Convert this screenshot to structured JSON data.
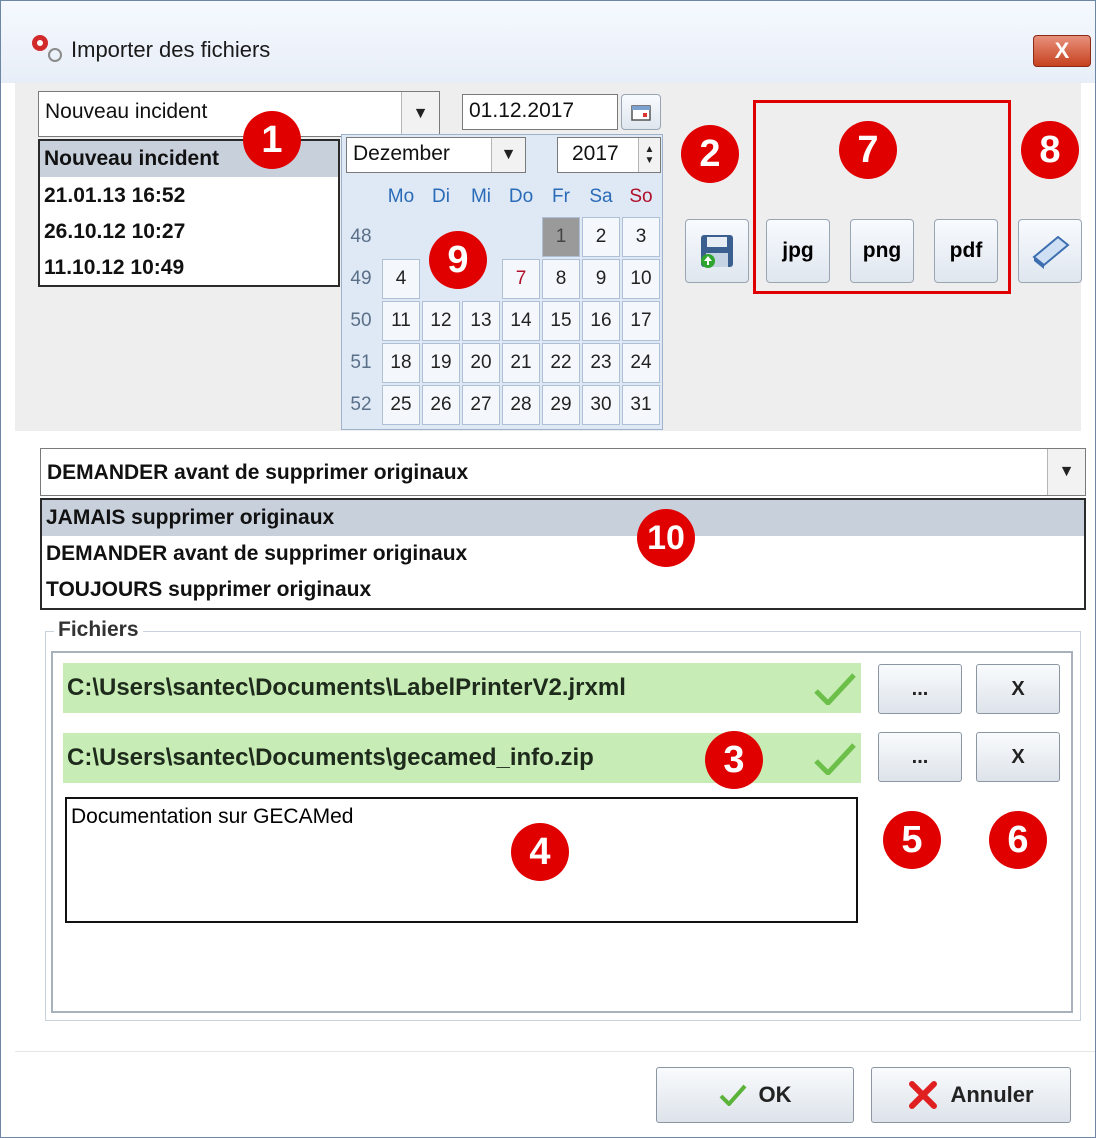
{
  "window": {
    "title": "Importer des fichiers",
    "close_label": "X"
  },
  "incident": {
    "selected": "Nouveau incident",
    "options": [
      "Nouveau incident",
      "21.01.13 16:52",
      "26.10.12 10:27",
      "11.10.12 10:49"
    ]
  },
  "date": {
    "value": "01.12.2017"
  },
  "calendar": {
    "month": "Dezember",
    "year": "2017",
    "weekdays": [
      "Mo",
      "Di",
      "Mi",
      "Do",
      "Fr",
      "Sa",
      "So"
    ],
    "weeks": [
      {
        "week": "48",
        "days": [
          "",
          "",
          "",
          "",
          "1",
          "2",
          "3"
        ]
      },
      {
        "week": "49",
        "days": [
          "4",
          "",
          "",
          "7",
          "8",
          "9",
          "10"
        ]
      },
      {
        "week": "50",
        "days": [
          "11",
          "12",
          "13",
          "14",
          "15",
          "16",
          "17"
        ]
      },
      {
        "week": "51",
        "days": [
          "18",
          "19",
          "20",
          "21",
          "22",
          "23",
          "24"
        ]
      },
      {
        "week": "52",
        "days": [
          "25",
          "26",
          "27",
          "28",
          "29",
          "30",
          "31"
        ]
      }
    ],
    "selected_day": "1",
    "colors": {
      "weekday": "#2a6bb8",
      "sunday": "#b0102a",
      "selected": "#9a9a9a"
    }
  },
  "toolbar": {
    "save_icon": "save-upload-icon",
    "jpg_label": "jpg",
    "png_label": "png",
    "pdf_label": "pdf",
    "scan_icon": "scanner-icon"
  },
  "delete_policy": {
    "selected": "DEMANDER avant de supprimer originaux",
    "options": [
      "JAMAIS supprimer originaux",
      "DEMANDER avant de supprimer originaux",
      "TOUJOURS supprimer originaux"
    ]
  },
  "files": {
    "legend": "Fichiers",
    "items": [
      {
        "path": "C:\\Users\\santec\\Documents\\LabelPrinterV2.jrxml"
      },
      {
        "path": "C:\\Users\\santec\\Documents\\gecamed_info.zip"
      }
    ],
    "browse_label": "...",
    "remove_label": "X",
    "description": "Documentation sur GECAMed"
  },
  "footer": {
    "ok_label": "OK",
    "cancel_label": "Annuler"
  },
  "badges": [
    "1",
    "2",
    "3",
    "4",
    "5",
    "6",
    "7",
    "8",
    "9",
    "10"
  ],
  "accent_colors": {
    "badge": "#e00000",
    "highlight_box": "#e00000",
    "file_row": "#c8ecb5",
    "list_selection": "#c8d0dc"
  }
}
